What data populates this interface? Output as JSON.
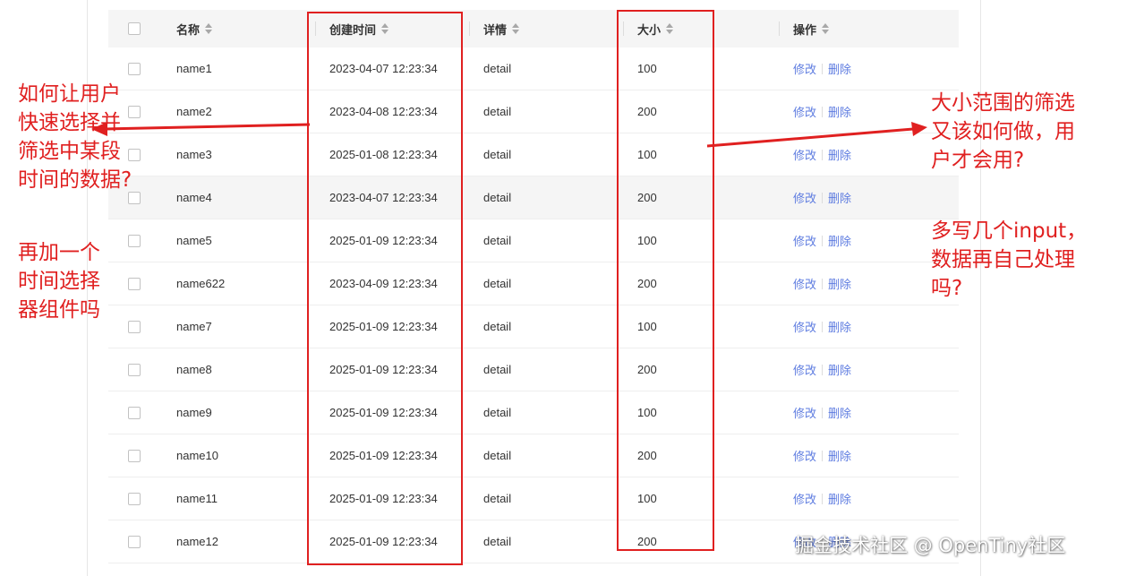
{
  "table": {
    "headers": {
      "name": "名称",
      "created_time": "创建时间",
      "detail": "详情",
      "size": "大小",
      "actions": "操作"
    },
    "rows": [
      {
        "name": "name1",
        "time": "2023-04-07 12:23:34",
        "detail": "detail",
        "size": "100",
        "edit": "修改",
        "delete": "删除"
      },
      {
        "name": "name2",
        "time": "2023-04-08 12:23:34",
        "detail": "detail",
        "size": "200",
        "edit": "修改",
        "delete": "删除"
      },
      {
        "name": "name3",
        "time": "2025-01-08 12:23:34",
        "detail": "detail",
        "size": "100",
        "edit": "修改",
        "delete": "删除"
      },
      {
        "name": "name4",
        "time": "2023-04-07 12:23:34",
        "detail": "detail",
        "size": "200",
        "edit": "修改",
        "delete": "删除"
      },
      {
        "name": "name5",
        "time": "2025-01-09 12:23:34",
        "detail": "detail",
        "size": "100",
        "edit": "修改",
        "delete": "删除"
      },
      {
        "name": "name622",
        "time": "2023-04-09 12:23:34",
        "detail": "detail",
        "size": "200",
        "edit": "修改",
        "delete": "删除"
      },
      {
        "name": "name7",
        "time": "2025-01-09 12:23:34",
        "detail": "detail",
        "size": "100",
        "edit": "修改",
        "delete": "删除"
      },
      {
        "name": "name8",
        "time": "2025-01-09 12:23:34",
        "detail": "detail",
        "size": "200",
        "edit": "修改",
        "delete": "删除"
      },
      {
        "name": "name9",
        "time": "2025-01-09 12:23:34",
        "detail": "detail",
        "size": "100",
        "edit": "修改",
        "delete": "删除"
      },
      {
        "name": "name10",
        "time": "2025-01-09 12:23:34",
        "detail": "detail",
        "size": "200",
        "edit": "修改",
        "delete": "删除"
      },
      {
        "name": "name11",
        "time": "2025-01-09 12:23:34",
        "detail": "detail",
        "size": "100",
        "edit": "修改",
        "delete": "删除"
      },
      {
        "name": "name12",
        "time": "2025-01-09 12:23:34",
        "detail": "detail",
        "size": "200",
        "edit": "修改",
        "delete": "删除"
      }
    ]
  },
  "annotations": {
    "left_question": "如何让用户\n快速选择并\n筛选中某段\n时间的数据?",
    "left_suggestion": "再加一个\n时间选择\n器组件吗",
    "right_question": "大小范围的筛选\n又该如何做，用\n户才会用?",
    "right_suggestion": "多写几个input，\n数据再自己处理\n吗?"
  },
  "watermark": "掘金技术社区 @ OpenTiny社区",
  "colors": {
    "annotation_red": "#e02020",
    "link_blue": "#5e7ce0",
    "header_bg": "#f5f5f5",
    "hover_row_bg": "#f5f5f5"
  },
  "icons": {
    "sort": "sort-icon",
    "checkbox": "checkbox-icon"
  }
}
